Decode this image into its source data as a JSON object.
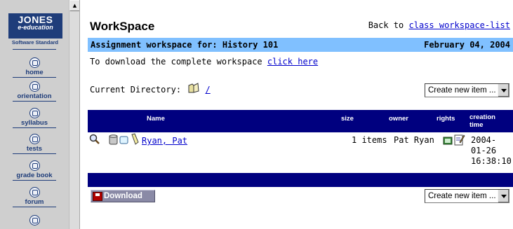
{
  "nav": {
    "logo_top": "JONES",
    "logo_sub": "e-education",
    "logo_tagline": "Software Standard",
    "items": [
      {
        "label": "home",
        "icon": "home-icon"
      },
      {
        "label": "orientation",
        "icon": "compass-icon"
      },
      {
        "label": "syllabus",
        "icon": "syllabus-icon"
      },
      {
        "label": "tests",
        "icon": "tests-icon"
      },
      {
        "label": "grade book",
        "icon": "gradebook-icon"
      },
      {
        "label": "forum",
        "icon": "forum-icon"
      }
    ]
  },
  "header": {
    "title": "WorkSpace",
    "back_prefix": "Back to",
    "back_link": "class workspace-list"
  },
  "assignment": {
    "label": "Assignment workspace for: History 101",
    "date": "February 04, 2004"
  },
  "download_note": {
    "text": "To download the complete workspace",
    "link": "click here"
  },
  "current_directory": {
    "label": "Current Directory:",
    "path": "/"
  },
  "create_item": {
    "label": "Create new item ..."
  },
  "table": {
    "columns": {
      "name": "Name",
      "size": "size",
      "owner": "owner",
      "rights": "rights",
      "creation_time": "creation time"
    },
    "rows": [
      {
        "name": "Ryan, Pat",
        "size": "1 items",
        "owner": "Pat Ryan",
        "time_line1": "2004-",
        "time_line2": "01-26",
        "time_line3": "16:38:10"
      }
    ]
  },
  "download_button": {
    "label": "Download"
  },
  "colors": {
    "nav_bg": "#cfcfcf",
    "assign_bar": "#80c0ff",
    "table_header": "#00007f",
    "link": "#0000cc"
  }
}
